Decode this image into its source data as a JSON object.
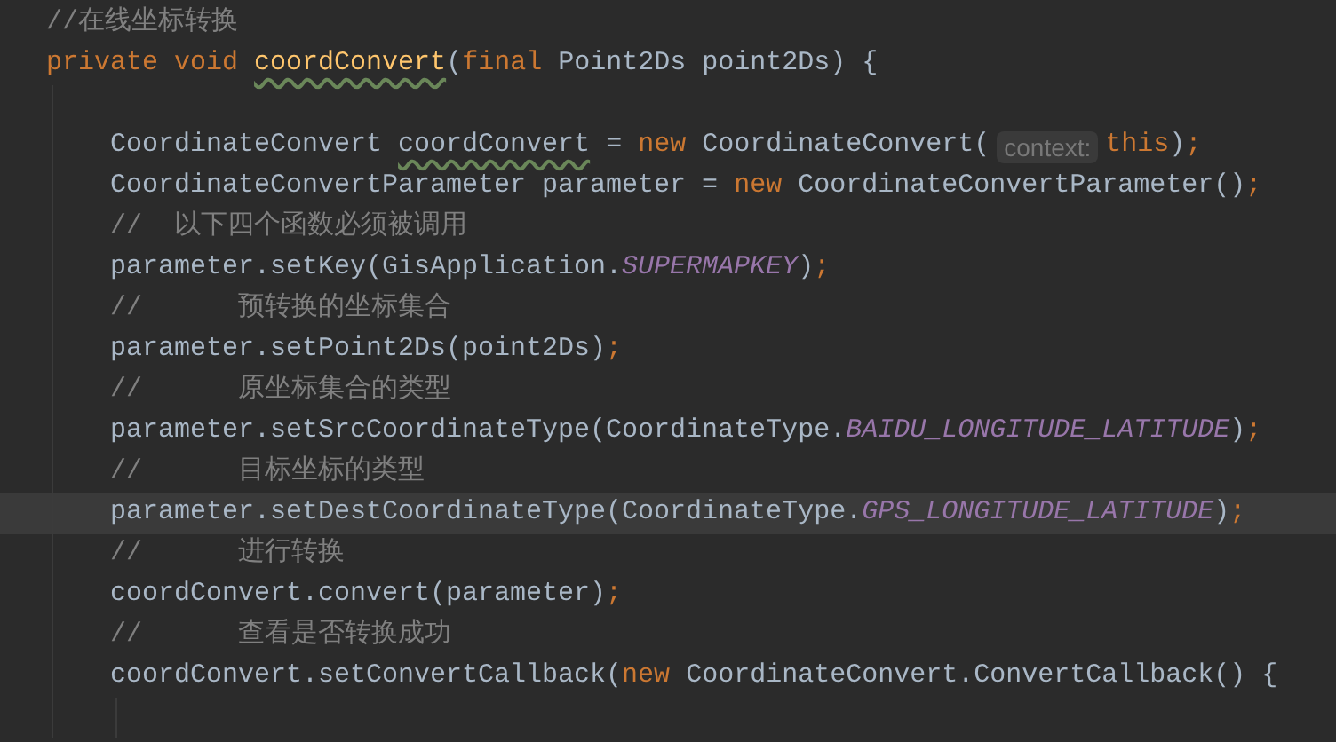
{
  "code": [
    {
      "current": false,
      "tokens": [
        {
          "kind": "comment",
          "text": "//在线坐标转换"
        }
      ]
    },
    {
      "current": false,
      "tokens": [
        {
          "kind": "keyword",
          "text": "private void "
        },
        {
          "kind": "method",
          "text": "coordConvert",
          "warning": true
        },
        {
          "kind": "plain",
          "text": "("
        },
        {
          "kind": "keyword",
          "text": "final "
        },
        {
          "kind": "plain",
          "text": "Point2Ds point2Ds) {"
        }
      ],
      "body": [
        {
          "current": false
        },
        {
          "current": false,
          "tokens": [
            {
              "kind": "plain",
              "text": "CoordinateConvert "
            },
            {
              "kind": "plain",
              "text": "coordConvert",
              "warning": true
            },
            {
              "kind": "plain",
              "text": " = "
            },
            {
              "kind": "keyword",
              "text": "new "
            },
            {
              "kind": "plain",
              "text": "CoordinateConvert("
            },
            {
              "kind": "hint",
              "text": "context:"
            },
            {
              "kind": "keyword",
              "text": "this"
            },
            {
              "kind": "plain",
              "text": ")"
            },
            {
              "kind": "punct",
              "text": ";"
            }
          ]
        },
        {
          "current": false,
          "tokens": [
            {
              "kind": "plain",
              "text": "CoordinateConvertParameter parameter = "
            },
            {
              "kind": "keyword",
              "text": "new "
            },
            {
              "kind": "plain",
              "text": "CoordinateConvertParameter()"
            },
            {
              "kind": "punct",
              "text": ";"
            }
          ]
        },
        {
          "current": false,
          "tokens": [
            {
              "kind": "comment",
              "text": "//  以下四个函数必须被调用"
            }
          ]
        },
        {
          "current": false,
          "tokens": [
            {
              "kind": "plain",
              "text": "parameter.setKey(GisApplication."
            },
            {
              "kind": "constant",
              "text": "SUPERMAPKEY"
            },
            {
              "kind": "plain",
              "text": ")"
            },
            {
              "kind": "punct",
              "text": ";"
            }
          ]
        },
        {
          "current": false,
          "tokens": [
            {
              "kind": "comment",
              "text": "//      预转换的坐标集合"
            }
          ]
        },
        {
          "current": false,
          "tokens": [
            {
              "kind": "plain",
              "text": "parameter.setPoint2Ds(point2Ds)"
            },
            {
              "kind": "punct",
              "text": ";"
            }
          ]
        },
        {
          "current": false,
          "tokens": [
            {
              "kind": "comment",
              "text": "//      原坐标集合的类型"
            }
          ]
        },
        {
          "current": false,
          "tokens": [
            {
              "kind": "plain",
              "text": "parameter.setSrcCoordinateType(CoordinateType."
            },
            {
              "kind": "constant",
              "text": "BAIDU_LONGITUDE_LATITUDE"
            },
            {
              "kind": "plain",
              "text": ")"
            },
            {
              "kind": "punct",
              "text": ";"
            }
          ]
        },
        {
          "current": false,
          "tokens": [
            {
              "kind": "comment",
              "text": "//      目标坐标的类型"
            }
          ]
        },
        {
          "current": true,
          "tokens": [
            {
              "kind": "plain",
              "text": "parameter.setDestCoordinateType(CoordinateType."
            },
            {
              "kind": "constant",
              "text": "GPS_LONGITUDE_LATITUDE"
            },
            {
              "kind": "plain",
              "text": ")"
            },
            {
              "kind": "punct",
              "text": ";"
            }
          ]
        },
        {
          "current": false,
          "tokens": [
            {
              "kind": "comment",
              "text": "//      进行转换"
            }
          ]
        },
        {
          "current": false,
          "tokens": [
            {
              "kind": "plain",
              "text": "coordConvert.convert(parameter)"
            },
            {
              "kind": "punct",
              "text": ";"
            }
          ]
        },
        {
          "current": false,
          "tokens": [
            {
              "kind": "comment",
              "text": "//      查看是否转换成功"
            }
          ]
        },
        {
          "current": false,
          "tokens": [
            {
              "kind": "plain",
              "text": "coordConvert.setConvertCallback("
            },
            {
              "kind": "keyword",
              "text": "new "
            },
            {
              "kind": "plain",
              "text": "CoordinateConvert.ConvertCallback() {"
            }
          ],
          "body": [
            {
              "current": false
            }
          ]
        }
      ]
    }
  ]
}
